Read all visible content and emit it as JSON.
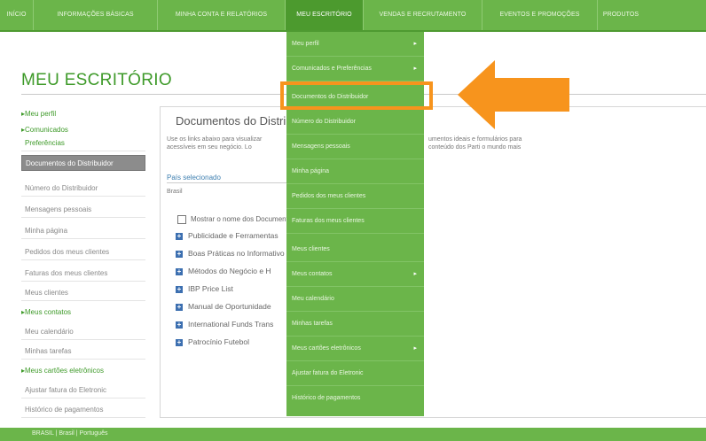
{
  "nav": {
    "items": [
      {
        "label": "INÍCIO"
      },
      {
        "label": "INFORMAÇÕES BÁSICAS"
      },
      {
        "label": "MINHA CONTA E RELATÓRIOS"
      },
      {
        "label": "MEU ESCRITÓRIO"
      },
      {
        "label": "VENDAS E RECRUTAMENTO"
      },
      {
        "label": "EVENTOS E PROMOÇÕES"
      },
      {
        "label": "PRODUTOS"
      }
    ]
  },
  "page": {
    "title": "MEU ESCRITÓRIO"
  },
  "sidebar": {
    "items": [
      {
        "label": "Meu perfil"
      },
      {
        "label": "Comunicados"
      },
      {
        "label": "Preferências"
      },
      {
        "label": "Documentos do Distribuidor"
      },
      {
        "label": "Número do Distribuidor"
      },
      {
        "label": "Mensagens pessoais"
      },
      {
        "label": "Minha página"
      },
      {
        "label": "Pedidos dos meus clientes"
      },
      {
        "label": "Faturas dos meus clientes"
      },
      {
        "label": "Meus clientes"
      },
      {
        "label": "Meus contatos"
      },
      {
        "label": "Meu calendário"
      },
      {
        "label": "Minhas tarefas"
      },
      {
        "label": "Meus cartões eletrônicos"
      },
      {
        "label": "Ajustar fatura do Eletronic"
      },
      {
        "label": "Histórico de pagamentos"
      }
    ]
  },
  "content": {
    "title": "Documentos do Distribuidor",
    "desc_left": [
      "Use os links abaixo para visualizar",
      "acessíveis em seu negócio. Lo"
    ],
    "desc_right": [
      "umentos ideais e formulários para",
      "conteúdo dos Parti o mundo mais"
    ],
    "country_label": "País selecionado",
    "country_value": "Brasil",
    "checkbox_label": "Mostrar o nome dos Documentos",
    "docs": [
      {
        "label": "Publicidade e Ferramentas"
      },
      {
        "label": "Boas Práticas no Informativo"
      },
      {
        "label": "Métodos do Negócio e H"
      },
      {
        "label": "IBP Price List"
      },
      {
        "label": "Manual de Oportunidade"
      },
      {
        "label": "International Funds Trans"
      },
      {
        "label": "Patrocínio Futebol"
      }
    ]
  },
  "dropdown": {
    "items": [
      {
        "label": "Meu perfil",
        "arrow": "▸"
      },
      {
        "label": "Comunicados e Preferências",
        "arrow": "▸"
      },
      {
        "label": "Documentos do Distribuidor",
        "arrow": ""
      },
      {
        "label": "Número do Distribuidor",
        "arrow": ""
      },
      {
        "label": "Mensagens pessoais",
        "arrow": ""
      },
      {
        "label": "Minha página",
        "arrow": ""
      },
      {
        "label": "Pedidos dos meus clientes",
        "arrow": ""
      },
      {
        "label": "Faturas dos meus clientes",
        "arrow": ""
      },
      {
        "label": "Meus clientes",
        "arrow": ""
      },
      {
        "label": "Meus contatos",
        "arrow": "▸"
      },
      {
        "label": "Meu calendário",
        "arrow": ""
      },
      {
        "label": "Minhas tarefas",
        "arrow": ""
      },
      {
        "label": "Meus cartões eletrônicos",
        "arrow": "▸"
      },
      {
        "label": "Ajustar fatura do Eletronic",
        "arrow": ""
      },
      {
        "label": "Histórico de pagamentos",
        "arrow": ""
      }
    ]
  },
  "footer": {
    "text": "BRASIL | Brasil | Português"
  },
  "colors": {
    "brand_green": "#6bb54a",
    "highlight_orange": "#f7941d",
    "title_green": "#3e9a29"
  }
}
